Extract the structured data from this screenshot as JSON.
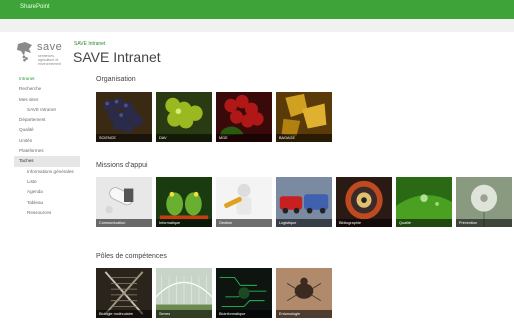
{
  "topbar": {
    "brand": "SharePoint",
    "color": "#3ea43a"
  },
  "logo": {
    "name": "save",
    "tagline": "semences, agriculture et environnement",
    "icon": "grape-leaf-icon"
  },
  "breadcrumb": "SAVE Intranet",
  "page_title": "SAVE Intranet",
  "nav": [
    {
      "label": "Intranet",
      "level": 0,
      "state": "first"
    },
    {
      "label": "Recherche",
      "level": 0
    },
    {
      "label": "Mes sites",
      "level": 0
    },
    {
      "label": "SAVE Intranet",
      "level": 1
    },
    {
      "label": "Département",
      "level": 0
    },
    {
      "label": "Qualité",
      "level": 0
    },
    {
      "label": "Unités",
      "level": 0
    },
    {
      "label": "Plateformes",
      "level": 0
    },
    {
      "label": "Taches",
      "level": 0,
      "state": "active"
    },
    {
      "label": "Informations générales",
      "level": 1
    },
    {
      "label": "Liste",
      "level": 1
    },
    {
      "label": "Agenda",
      "level": 1
    },
    {
      "label": "Tableau",
      "level": 1
    },
    {
      "label": "Ressources",
      "level": 1
    }
  ],
  "sections": [
    {
      "title": "Organisation",
      "tiles": [
        {
          "label": "SCIENCE",
          "art": "grapes-dark"
        },
        {
          "label": "DAV",
          "art": "grapes-green"
        },
        {
          "label": "MGE",
          "art": "grapes-red"
        },
        {
          "label": "BAGAGE",
          "art": "leaves-yellow"
        }
      ]
    },
    {
      "title": "Missions d'appui",
      "tiles": [
        {
          "label": "Communication",
          "art": "pills"
        },
        {
          "label": "Informatique",
          "art": "frogs"
        },
        {
          "label": "Gestion",
          "art": "wrench-man"
        },
        {
          "label": "Logistique",
          "art": "cars"
        },
        {
          "label": "Bibliographie",
          "art": "wheel"
        },
        {
          "label": "Qualité",
          "art": "water-leaf"
        },
        {
          "label": "Prévention",
          "art": "dandelion"
        }
      ]
    },
    {
      "title": "Pôles de compétences",
      "tiles": [
        {
          "label": "Biologie moléculaire",
          "art": "dna"
        },
        {
          "label": "Serres",
          "art": "greenhouse"
        },
        {
          "label": "Bioinformatique",
          "art": "circuit"
        },
        {
          "label": "Entomologie",
          "art": "insect"
        }
      ]
    }
  ]
}
